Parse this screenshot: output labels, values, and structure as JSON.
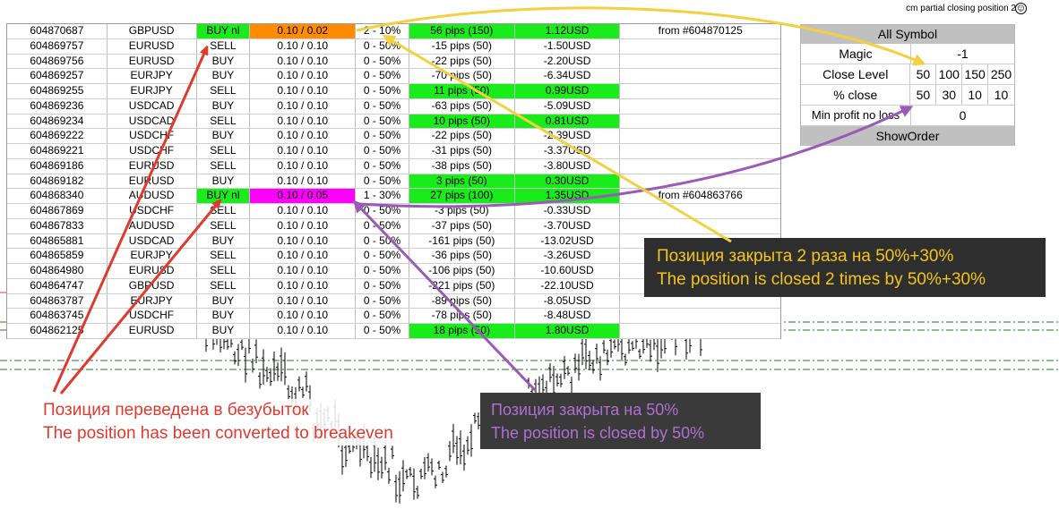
{
  "header": {
    "title": "cm partial closing position 2",
    "icon": "smiley-icon"
  },
  "orders": [
    {
      "ticket": "604870687",
      "symbol": "GBPUSD",
      "type": "BUY nl",
      "lots": "0.10 / 0.02",
      "level": "2 - 10%",
      "pips": "56 pips (150)",
      "profit": "1.12USD",
      "note": "from #604870125",
      "type_bg": "#1aeb1a",
      "lots_bg": "#ff8c00",
      "pips_bg": "#1aeb1a",
      "profit_bg": "#1aeb1a"
    },
    {
      "ticket": "604869757",
      "symbol": "EURUSD",
      "type": "SELL",
      "lots": "0.10 / 0.10",
      "level": "0 - 50%",
      "pips": "-15 pips (50)",
      "profit": "-1.50USD",
      "note": ""
    },
    {
      "ticket": "604869756",
      "symbol": "EURUSD",
      "type": "BUY",
      "lots": "0.10 / 0.10",
      "level": "0 - 50%",
      "pips": "-22 pips (50)",
      "profit": "-2.20USD",
      "note": ""
    },
    {
      "ticket": "604869257",
      "symbol": "EURJPY",
      "type": "BUY",
      "lots": "0.10 / 0.10",
      "level": "0 - 50%",
      "pips": "-70 pips (50)",
      "profit": "-6.34USD",
      "note": ""
    },
    {
      "ticket": "604869255",
      "symbol": "EURJPY",
      "type": "SELL",
      "lots": "0.10 / 0.10",
      "level": "0 - 50%",
      "pips": "11 pips (50)",
      "profit": "0.99USD",
      "note": "",
      "pips_bg": "#1aeb1a",
      "profit_bg": "#1aeb1a"
    },
    {
      "ticket": "604869236",
      "symbol": "USDCAD",
      "type": "BUY",
      "lots": "0.10 / 0.10",
      "level": "0 - 50%",
      "pips": "-63 pips (50)",
      "profit": "-5.09USD",
      "note": ""
    },
    {
      "ticket": "604869234",
      "symbol": "USDCAD",
      "type": "SELL",
      "lots": "0.10 / 0.10",
      "level": "0 - 50%",
      "pips": "10 pips (50)",
      "profit": "0.81USD",
      "note": "",
      "pips_bg": "#1aeb1a",
      "profit_bg": "#1aeb1a"
    },
    {
      "ticket": "604869222",
      "symbol": "USDCHF",
      "type": "BUY",
      "lots": "0.10 / 0.10",
      "level": "0 - 50%",
      "pips": "-22 pips (50)",
      "profit": "-2.39USD",
      "note": ""
    },
    {
      "ticket": "604869221",
      "symbol": "USDCHF",
      "type": "SELL",
      "lots": "0.10 / 0.10",
      "level": "0 - 50%",
      "pips": "-31 pips (50)",
      "profit": "-3.37USD",
      "note": ""
    },
    {
      "ticket": "604869186",
      "symbol": "EURUSD",
      "type": "SELL",
      "lots": "0.10 / 0.10",
      "level": "0 - 50%",
      "pips": "-38 pips (50)",
      "profit": "-3.80USD",
      "note": ""
    },
    {
      "ticket": "604869182",
      "symbol": "EURUSD",
      "type": "BUY",
      "lots": "0.10 / 0.10",
      "level": "0 - 50%",
      "pips": "3 pips (50)",
      "profit": "0.30USD",
      "note": "",
      "pips_bg": "#1aeb1a",
      "profit_bg": "#1aeb1a"
    },
    {
      "ticket": "604868340",
      "symbol": "AUDUSD",
      "type": "BUY nl",
      "lots": "0.10 / 0.05",
      "level": "1 - 30%",
      "pips": "27 pips (100)",
      "profit": "1.35USD",
      "note": "from #604863766",
      "type_bg": "#1aeb1a",
      "lots_bg": "#ff00ff",
      "pips_bg": "#1aeb1a",
      "profit_bg": "#1aeb1a"
    },
    {
      "ticket": "604867869",
      "symbol": "USDCHF",
      "type": "SELL",
      "lots": "0.10 / 0.10",
      "level": "0 - 50%",
      "pips": "-3 pips (50)",
      "profit": "-0.33USD",
      "note": ""
    },
    {
      "ticket": "604867833",
      "symbol": "AUDUSD",
      "type": "SELL",
      "lots": "0.10 / 0.10",
      "level": "0 - 50%",
      "pips": "-37 pips (50)",
      "profit": "-3.70USD",
      "note": ""
    },
    {
      "ticket": "604865881",
      "symbol": "USDCAD",
      "type": "BUY",
      "lots": "0.10 / 0.10",
      "level": "0 - 50%",
      "pips": "-161 pips (50)",
      "profit": "-13.02USD",
      "note": ""
    },
    {
      "ticket": "604865859",
      "symbol": "EURJPY",
      "type": "SELL",
      "lots": "0.10 / 0.10",
      "level": "0 - 50%",
      "pips": "-36 pips (50)",
      "profit": "-3.26USD",
      "note": ""
    },
    {
      "ticket": "604864980",
      "symbol": "EURUSD",
      "type": "SELL",
      "lots": "0.10 / 0.10",
      "level": "0 - 50%",
      "pips": "-106 pips (50)",
      "profit": "-10.60USD",
      "note": ""
    },
    {
      "ticket": "604864747",
      "symbol": "GBPUSD",
      "type": "SELL",
      "lots": "0.10 / 0.10",
      "level": "0 - 50%",
      "pips": "-221 pips (50)",
      "profit": "-22.10USD",
      "note": ""
    },
    {
      "ticket": "604863787",
      "symbol": "EURJPY",
      "type": "BUY",
      "lots": "0.10 / 0.10",
      "level": "0 - 50%",
      "pips": "-89 pips (50)",
      "profit": "-8.05USD",
      "note": ""
    },
    {
      "ticket": "604863745",
      "symbol": "USDCHF",
      "type": "BUY",
      "lots": "0.10 / 0.10",
      "level": "0 - 50%",
      "pips": "-78 pips (50)",
      "profit": "-8.48USD",
      "note": ""
    },
    {
      "ticket": "604862125",
      "symbol": "EURUSD",
      "type": "BUY",
      "lots": "0.10 / 0.10",
      "level": "0 - 50%",
      "pips": "18 pips (50)",
      "profit": "1.80USD",
      "note": "",
      "pips_bg": "#1aeb1a",
      "profit_bg": "#1aeb1a"
    }
  ],
  "panel": {
    "all_symbol": "All Symbol",
    "magic_label": "Magic",
    "magic_value": "-1",
    "close_level_label": "Close Level",
    "close_levels": [
      "50",
      "100",
      "150",
      "250"
    ],
    "percent_close_label": "% close",
    "percent_close": [
      "50",
      "30",
      "10",
      "10"
    ],
    "min_profit_label": "Min profit no loss",
    "min_profit_value": "0",
    "show_order": "ShowOrder"
  },
  "annotations": {
    "red_line1": "Позиция переведена в безубыток",
    "red_line2": "The position has been converted to breakeven",
    "purple_line1": "Позиция закрыта на 50%",
    "purple_line2": "The position is closed by 50%",
    "yellow_line1": "Позиция закрыта 2 раза на 50%+30%",
    "yellow_line2": "The position is closed 2 times by 50%+30%"
  },
  "colors": {
    "green": "#1aeb1a",
    "orange": "#ff8c00",
    "magenta": "#ff00ff",
    "red_arrow": "#e03a2e",
    "purple_arrow": "#9b5ab8",
    "yellow_arrow": "#f4d03f"
  }
}
